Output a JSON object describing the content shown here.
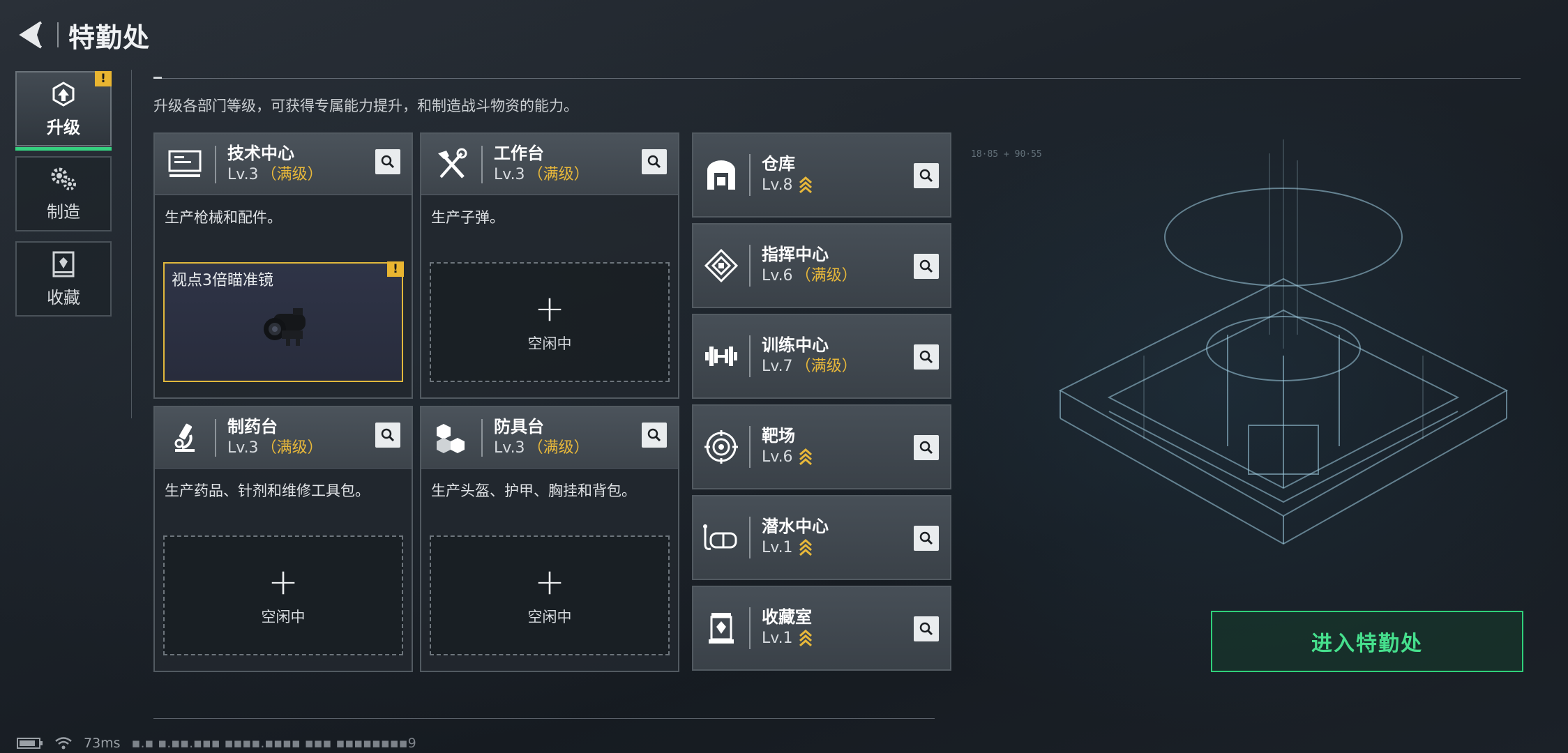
{
  "header": {
    "title": "特勤处"
  },
  "sidebar": {
    "items": [
      {
        "label": "升级",
        "active": true,
        "alert": "!"
      },
      {
        "label": "制造",
        "active": false
      },
      {
        "label": "收藏",
        "active": false
      }
    ]
  },
  "description": "升级各部门等级，可获得专属能力提升，和制造战斗物资的能力。",
  "workshops": [
    {
      "name": "技术中心",
      "level": "Lv.3",
      "max_tag": "（满级）",
      "desc": "生产枪械和配件。",
      "icon": "computer-icon",
      "slot": {
        "state": "busy",
        "item_name": "视点3倍瞄准镜",
        "alert": "!"
      }
    },
    {
      "name": "工作台",
      "level": "Lv.3",
      "max_tag": "（满级）",
      "desc": "生产子弹。",
      "icon": "tools-icon",
      "slot": {
        "state": "idle",
        "plus": "+",
        "label": "空闲中"
      }
    },
    {
      "name": "制药台",
      "level": "Lv.3",
      "max_tag": "（满级）",
      "desc": "生产药品、针剂和维修工具包。",
      "icon": "microscope-icon",
      "slot": {
        "state": "idle",
        "plus": "+",
        "label": "空闲中"
      }
    },
    {
      "name": "防具台",
      "level": "Lv.3",
      "max_tag": "（满级）",
      "desc": "生产头盔、护甲、胸挂和背包。",
      "icon": "cubes-icon",
      "slot": {
        "state": "idle",
        "plus": "+",
        "label": "空闲中"
      }
    }
  ],
  "facilities": [
    {
      "name": "仓库",
      "level": "Lv.8",
      "max_tag": "",
      "upgradable": true,
      "icon": "warehouse-icon"
    },
    {
      "name": "指挥中心",
      "level": "Lv.6",
      "max_tag": "（满级）",
      "upgradable": false,
      "icon": "command-icon"
    },
    {
      "name": "训练中心",
      "level": "Lv.7",
      "max_tag": "（满级）",
      "upgradable": false,
      "icon": "dumbbell-icon"
    },
    {
      "name": "靶场",
      "level": "Lv.6",
      "max_tag": "",
      "upgradable": true,
      "icon": "target-icon"
    },
    {
      "name": "潜水中心",
      "level": "Lv.1",
      "max_tag": "",
      "upgradable": true,
      "icon": "diving-mask-icon"
    },
    {
      "name": "收藏室",
      "level": "Lv.1",
      "max_tag": "",
      "upgradable": true,
      "icon": "collection-icon"
    }
  ],
  "enter_button": "进入特勤处",
  "status": {
    "ping": "73ms",
    "build": "▪.▪ ▪.▪▪.▪▪▪ ▪▪▪▪.▪▪▪▪ ▪▪▪ ▪▪▪▪▪▪▪▪9"
  },
  "colors": {
    "accent_green": "#35d07f",
    "max_gold": "#e8b83a",
    "alert_yellow": "#e9b531"
  }
}
